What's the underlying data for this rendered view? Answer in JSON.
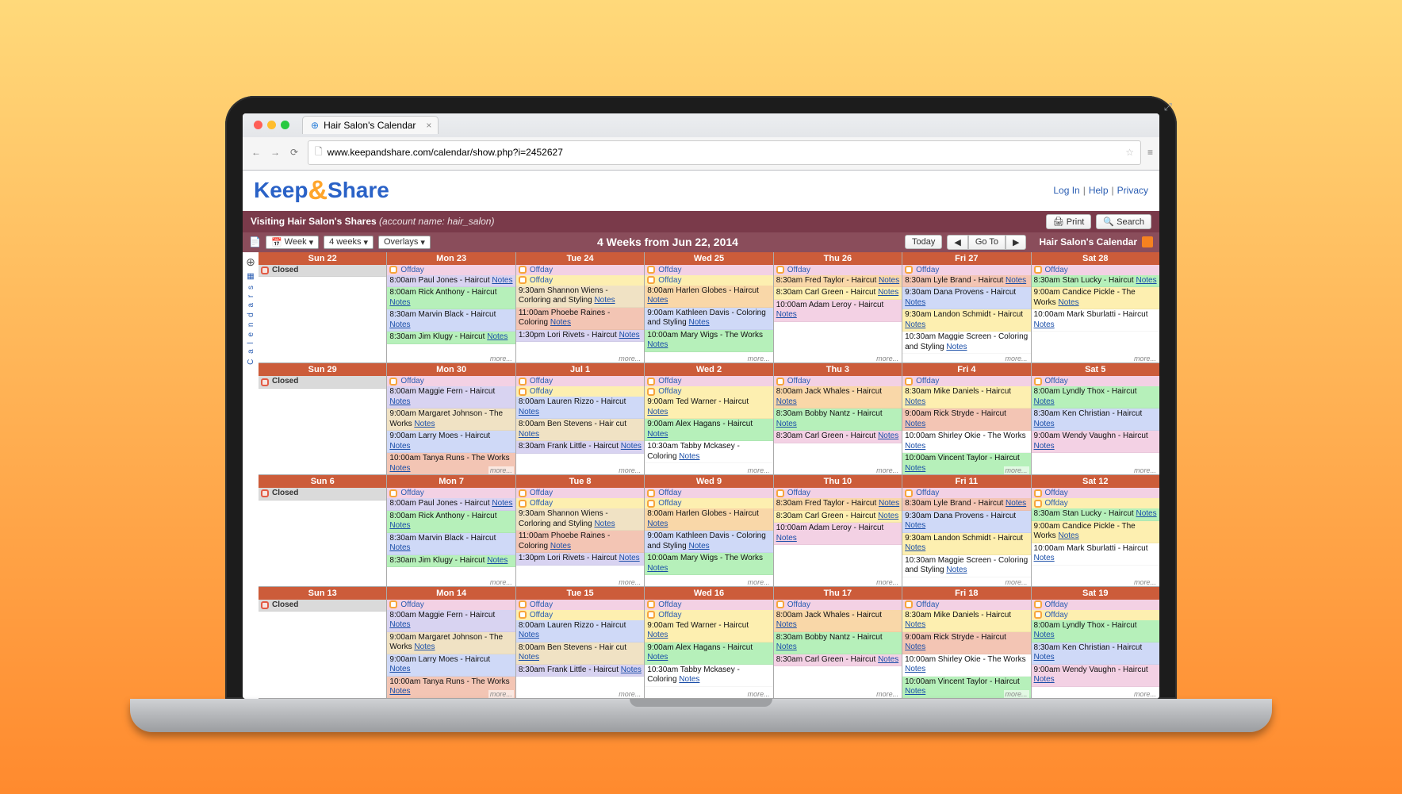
{
  "browser": {
    "tab_title": "Hair Salon's Calendar",
    "url": "www.keepandshare.com/calendar/show.php?i=2452627"
  },
  "logo": {
    "keep": "Keep",
    "amp": "&",
    "share": "Share"
  },
  "header_links": [
    "Log In",
    "Help",
    "Privacy"
  ],
  "context": {
    "prefix": "Visiting Hair Salon's Shares",
    "accountLabel": "(account name:",
    "account": "hair_salon)",
    "print": "Print",
    "search": "Search"
  },
  "titlebar": {
    "week": "Week",
    "weeks": "4 weeks",
    "overlays": "Overlays",
    "title": "4 Weeks from Jun 22, 2014",
    "today": "Today",
    "goto": "Go To",
    "cal_name": "Hair Salon's Calendar"
  },
  "siderail": {
    "label": "C a l e n d a r s"
  },
  "common": {
    "closed": "Closed",
    "offday": "Offday",
    "notes": "Notes",
    "more": "more..."
  },
  "weeks": [
    {
      "days": [
        {
          "head": "Sun 22",
          "closed": true,
          "events": []
        },
        {
          "head": "Mon 23",
          "offdays": 1,
          "events": [
            {
              "t": "8:00am Paul Jones - Haircut",
              "c": "c-lav"
            },
            {
              "t": "8:00am Rick Anthony - Haircut",
              "c": "c-green"
            },
            {
              "t": "8:30am Marvin Black - Haircut",
              "c": "c-blue"
            },
            {
              "t": "8:30am Jim Klugy - Haircut",
              "c": "c-green"
            }
          ]
        },
        {
          "head": "Tue 24",
          "offdays": 2,
          "events": [
            {
              "t": "9:30am Shannon Wiens - Corloring and Styling",
              "c": "c-tan"
            },
            {
              "t": "11:00am Phoebe Raines - Coloring",
              "c": "c-coral"
            },
            {
              "t": "1:30pm Lori Rivets - Haircut",
              "c": "c-lav"
            }
          ]
        },
        {
          "head": "Wed 25",
          "offdays": 2,
          "events": [
            {
              "t": "8:00am Harlen Globes - Haircut",
              "c": "c-orange"
            },
            {
              "t": "9:00am Kathleen Davis - Coloring and Styling",
              "c": "c-blue"
            },
            {
              "t": "10:00am Mary Wigs - The Works",
              "c": "c-green"
            }
          ]
        },
        {
          "head": "Thu 26",
          "offdays": 1,
          "events": [
            {
              "t": "8:30am Fred Taylor - Haircut",
              "c": "c-orange"
            },
            {
              "t": "8:30am Carl Green - Haircut",
              "c": "c-yellow"
            },
            {
              "t": "10:00am Adam Leroy - Haircut",
              "c": "c-pink"
            }
          ]
        },
        {
          "head": "Fri 27",
          "offdays": 1,
          "events": [
            {
              "t": "8:30am Lyle Brand - Haircut",
              "c": "c-coral"
            },
            {
              "t": "9:30am Dana Provens - Haircut",
              "c": "c-blue"
            },
            {
              "t": "9:30am Landon Schmidt - Haircut",
              "c": "c-yellow"
            },
            {
              "t": "10:30am Maggie Screen - Coloring and Styling",
              "c": "c-white"
            }
          ]
        },
        {
          "head": "Sat 28",
          "offdays": 1,
          "events": [
            {
              "t": "8:30am Stan Lucky - Haircut",
              "c": "c-green"
            },
            {
              "t": "9:00am Candice Pickle - The Works",
              "c": "c-yellow"
            },
            {
              "t": "10:00am Mark Sburlatti - Haircut",
              "c": "c-white"
            }
          ]
        }
      ]
    },
    {
      "days": [
        {
          "head": "Sun 29",
          "closed": true,
          "events": []
        },
        {
          "head": "Mon 30",
          "offdays": 1,
          "events": [
            {
              "t": "8:00am Maggie Fern - Haircut",
              "c": "c-lav"
            },
            {
              "t": "9:00am Margaret Johnson - The Works",
              "c": "c-tan"
            },
            {
              "t": "9:00am Larry Moes - Haircut",
              "c": "c-blue"
            },
            {
              "t": "10:00am Tanya Runs - The Works",
              "c": "c-coral"
            }
          ]
        },
        {
          "head": "Jul 1",
          "offdays": 2,
          "events": [
            {
              "t": "8:00am Lauren Rizzo - Haircut",
              "c": "c-blue"
            },
            {
              "t": "8:00am Ben Stevens - Hair cut",
              "c": "c-tan"
            },
            {
              "t": "8:30am Frank Little - Haircut",
              "c": "c-lav"
            }
          ]
        },
        {
          "head": "Wed 2",
          "offdays": 2,
          "events": [
            {
              "t": "9:00am Ted Warner - Haircut",
              "c": "c-yellow"
            },
            {
              "t": "9:00am Alex Hagans - Haircut",
              "c": "c-green"
            },
            {
              "t": "10:30am Tabby Mckasey - Coloring",
              "c": "c-white"
            }
          ]
        },
        {
          "head": "Thu 3",
          "offdays": 1,
          "events": [
            {
              "t": "8:00am Jack Whales - Haircut",
              "c": "c-orange"
            },
            {
              "t": "8:30am Bobby Nantz - Haircut",
              "c": "c-green"
            },
            {
              "t": "8:30am Carl Green - Haircut",
              "c": "c-pink"
            }
          ]
        },
        {
          "head": "Fri 4",
          "offdays": 1,
          "events": [
            {
              "t": "8:30am Mike Daniels - Haircut",
              "c": "c-yellow"
            },
            {
              "t": "9:00am Rick Stryde - Haircut",
              "c": "c-coral"
            },
            {
              "t": "10:00am Shirley Okie - The Works",
              "c": "c-white"
            },
            {
              "t": "10:00am Vincent Taylor - Haircut",
              "c": "c-green"
            }
          ]
        },
        {
          "head": "Sat 5",
          "offdays": 1,
          "events": [
            {
              "t": "8:00am Lyndly Thox - Haircut",
              "c": "c-green"
            },
            {
              "t": "8:30am Ken Christian - Haircut",
              "c": "c-blue"
            },
            {
              "t": "9:00am Wendy Vaughn - Haircut",
              "c": "c-pink"
            }
          ]
        }
      ]
    },
    {
      "days": [
        {
          "head": "Sun 6",
          "closed": true,
          "events": []
        },
        {
          "head": "Mon 7",
          "offdays": 1,
          "events": [
            {
              "t": "8:00am Paul Jones - Haircut",
              "c": "c-lav"
            },
            {
              "t": "8:00am Rick Anthony - Haircut",
              "c": "c-green"
            },
            {
              "t": "8:30am Marvin Black - Haircut",
              "c": "c-blue"
            },
            {
              "t": "8:30am Jim Klugy - Haircut",
              "c": "c-green"
            }
          ]
        },
        {
          "head": "Tue 8",
          "offdays": 2,
          "events": [
            {
              "t": "9:30am Shannon Wiens - Corloring and Styling",
              "c": "c-tan"
            },
            {
              "t": "11:00am Phoebe Raines - Coloring",
              "c": "c-coral"
            },
            {
              "t": "1:30pm Lori Rivets - Haircut",
              "c": "c-lav"
            }
          ]
        },
        {
          "head": "Wed 9",
          "offdays": 2,
          "events": [
            {
              "t": "8:00am Harlen Globes - Haircut",
              "c": "c-orange"
            },
            {
              "t": "9:00am Kathleen Davis - Coloring and Styling",
              "c": "c-blue"
            },
            {
              "t": "10:00am Mary Wigs - The Works",
              "c": "c-green"
            }
          ]
        },
        {
          "head": "Thu 10",
          "offdays": 1,
          "events": [
            {
              "t": "8:30am Fred Taylor - Haircut",
              "c": "c-orange"
            },
            {
              "t": "8:30am Carl Green - Haircut",
              "c": "c-yellow"
            },
            {
              "t": "10:00am Adam Leroy - Haircut",
              "c": "c-pink"
            }
          ]
        },
        {
          "head": "Fri 11",
          "offdays": 1,
          "events": [
            {
              "t": "8:30am Lyle Brand - Haircut",
              "c": "c-coral"
            },
            {
              "t": "9:30am Dana Provens - Haircut",
              "c": "c-blue"
            },
            {
              "t": "9:30am Landon Schmidt - Haircut",
              "c": "c-yellow"
            },
            {
              "t": "10:30am Maggie Screen - Coloring and Styling",
              "c": "c-white"
            }
          ]
        },
        {
          "head": "Sat 12",
          "offdays": 2,
          "events": [
            {
              "t": "8:30am Stan Lucky - Haircut",
              "c": "c-green"
            },
            {
              "t": "9:00am Candice Pickle - The Works",
              "c": "c-yellow"
            },
            {
              "t": "10:00am Mark Sburlatti - Haircut",
              "c": "c-white"
            }
          ]
        }
      ]
    },
    {
      "days": [
        {
          "head": "Sun 13",
          "closed": true,
          "events": []
        },
        {
          "head": "Mon 14",
          "offdays": 1,
          "events": [
            {
              "t": "8:00am Maggie Fern - Haircut",
              "c": "c-lav"
            },
            {
              "t": "9:00am Margaret Johnson - The Works",
              "c": "c-tan"
            },
            {
              "t": "9:00am Larry Moes - Haircut",
              "c": "c-blue"
            },
            {
              "t": "10:00am Tanya Runs - The Works",
              "c": "c-coral"
            }
          ]
        },
        {
          "head": "Tue 15",
          "offdays": 2,
          "events": [
            {
              "t": "8:00am Lauren Rizzo - Haircut",
              "c": "c-blue"
            },
            {
              "t": "8:00am Ben Stevens - Hair cut",
              "c": "c-tan"
            },
            {
              "t": "8:30am Frank Little - Haircut",
              "c": "c-lav"
            }
          ]
        },
        {
          "head": "Wed 16",
          "offdays": 2,
          "events": [
            {
              "t": "9:00am Ted Warner - Haircut",
              "c": "c-yellow"
            },
            {
              "t": "9:00am Alex Hagans - Haircut",
              "c": "c-green"
            },
            {
              "t": "10:30am Tabby Mckasey - Coloring",
              "c": "c-white"
            }
          ]
        },
        {
          "head": "Thu 17",
          "offdays": 1,
          "events": [
            {
              "t": "8:00am Jack Whales - Haircut",
              "c": "c-orange"
            },
            {
              "t": "8:30am Bobby Nantz - Haircut",
              "c": "c-green"
            },
            {
              "t": "8:30am Carl Green - Haircut",
              "c": "c-pink"
            }
          ]
        },
        {
          "head": "Fri 18",
          "offdays": 1,
          "events": [
            {
              "t": "8:30am Mike Daniels - Haircut",
              "c": "c-yellow"
            },
            {
              "t": "9:00am Rick Stryde - Haircut",
              "c": "c-coral"
            },
            {
              "t": "10:00am Shirley Okie - The Works",
              "c": "c-white"
            },
            {
              "t": "10:00am Vincent Taylor - Haircut",
              "c": "c-green"
            }
          ]
        },
        {
          "head": "Sat 19",
          "offdays": 2,
          "events": [
            {
              "t": "8:00am Lyndly Thox - Haircut",
              "c": "c-green"
            },
            {
              "t": "8:30am Ken Christian - Haircut",
              "c": "c-blue"
            },
            {
              "t": "9:00am Wendy Vaughn - Haircut",
              "c": "c-pink"
            }
          ]
        }
      ]
    }
  ]
}
